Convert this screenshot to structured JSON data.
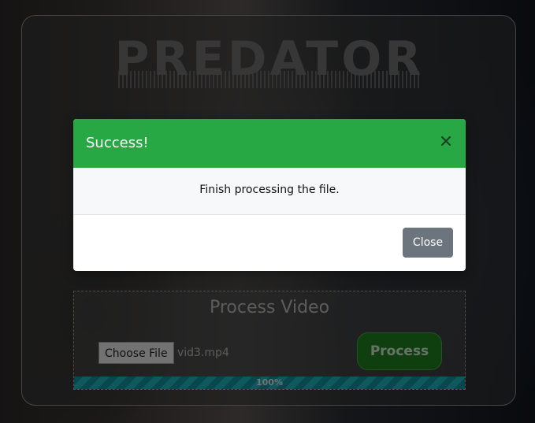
{
  "page": {
    "logo_text": "PREDATOR"
  },
  "upload": {
    "title": "Process Video",
    "choose_file_label": "Choose File",
    "file_name": "vid3.mp4",
    "process_label": "Process",
    "progress_value": 100,
    "progress_text": "100%"
  },
  "modal": {
    "title": "Success!",
    "message": "Finish processing the file.",
    "close_label": "Close",
    "close_icon": "close-icon",
    "header_color": "#28a745"
  }
}
